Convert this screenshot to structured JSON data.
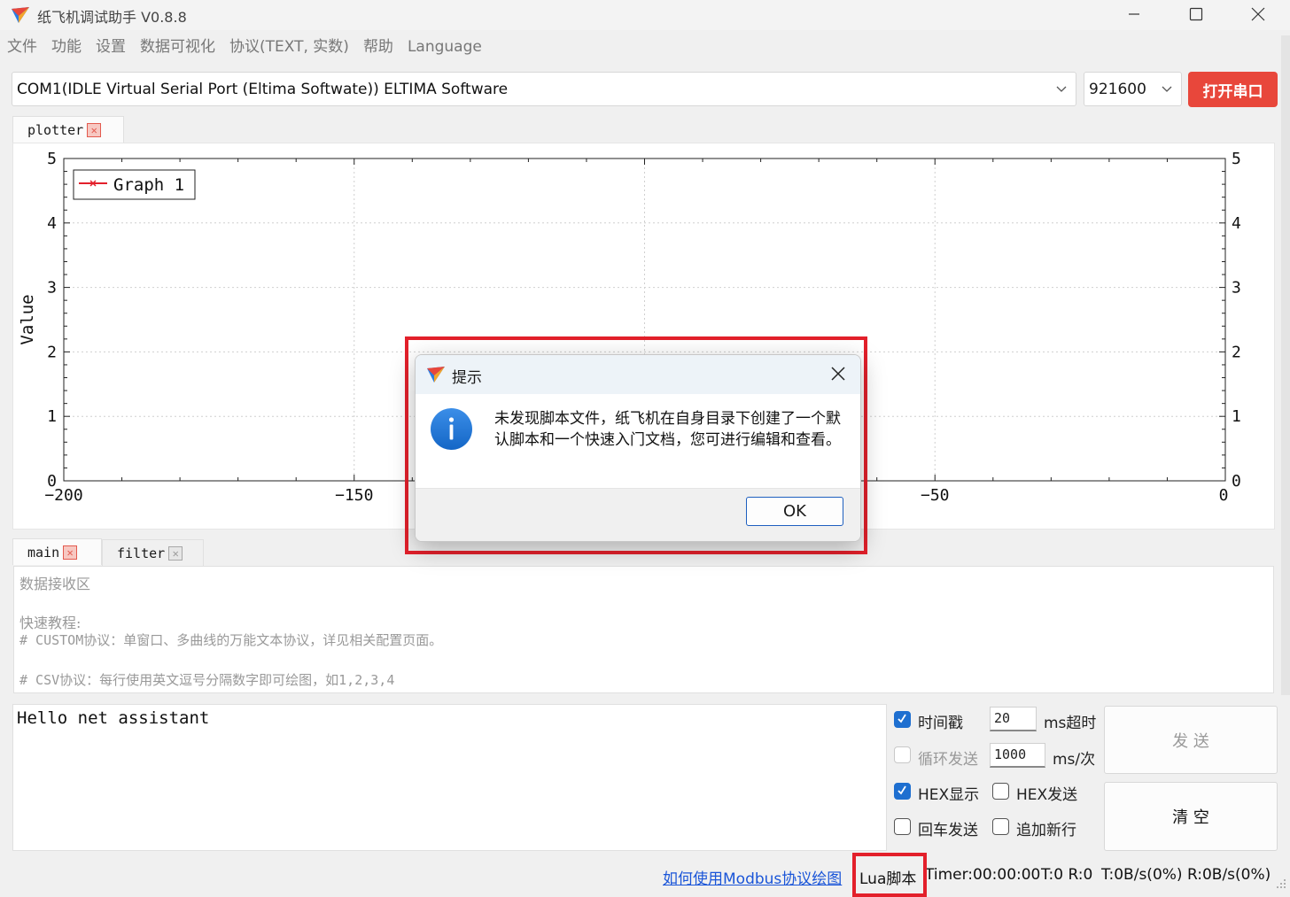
{
  "window": {
    "title": "纸飞机调试助手 V0.8.8"
  },
  "menu": [
    "文件",
    "功能",
    "设置",
    "数据可视化",
    "协议(TEXT, 实数)",
    "帮助",
    "Language"
  ],
  "port": {
    "selected": "COM1(IDLE  Virtual Serial Port (Eltima Softwate)) ELTIMA Software",
    "baud": "921600",
    "open_button": "打开串口"
  },
  "plot_tab": {
    "label": "plotter",
    "close": "✕"
  },
  "chart_data": {
    "type": "line",
    "series": [
      {
        "name": "Graph 1",
        "x": [],
        "y": [],
        "color": "#e3202b"
      }
    ],
    "ylabel": "Value",
    "xlim": [
      -200,
      0
    ],
    "ylim": [
      0,
      5
    ],
    "x_ticks": [
      "−200",
      "−150",
      "−100",
      "−50",
      "0"
    ],
    "y_ticks": [
      "0",
      "1",
      "2",
      "3",
      "4",
      "5"
    ],
    "y_ticks_right": [
      "0",
      "1",
      "2",
      "3",
      "4",
      "5"
    ],
    "grid": true,
    "legend": "top-left"
  },
  "data_tabs": [
    {
      "label": "main",
      "close": "✕"
    },
    {
      "label": "filter",
      "close": "✕"
    }
  ],
  "receive": {
    "title": "数据接收区",
    "tutorial_header": "快速教程:",
    "line1": "# CUSTOM协议：单窗口、多曲线的万能文本协议，详见相关配置页面。",
    "line2": "# CSV协议：每行使用英文逗号分隔数字即可绘图，如1,2,3,4"
  },
  "send": {
    "text": "Hello net assistant"
  },
  "options": {
    "timestamp": {
      "label": "时间戳",
      "checked": true,
      "value": "20",
      "unit": "ms超时"
    },
    "loop_send": {
      "label": "循环发送",
      "checked": false,
      "value": "1000",
      "unit": "ms/次"
    },
    "hex_display": {
      "label": "HEX显示",
      "checked": true
    },
    "hex_send": {
      "label": "HEX发送",
      "checked": false
    },
    "enter_send": {
      "label": "回车发送",
      "checked": false
    },
    "append_newline": {
      "label": "追加新行",
      "checked": false
    }
  },
  "buttons": {
    "send": "发 送",
    "clear": "清 空"
  },
  "status": {
    "modbus_link": "如何使用Modbus协议绘图",
    "lua": "Lua脚本",
    "timer": "Timer:00:00:00",
    "tr": "T:0 R:0",
    "rate": "T:0B/s(0%) R:0B/s(0%)"
  },
  "dialog": {
    "title": "提示",
    "message": "未发现脚本文件，纸飞机在自身目录下创建了一个默认脚本和一个快速入门文档，您可进行编辑和查看。",
    "ok": "OK"
  },
  "colors": {
    "accent": "#e8473b",
    "highlight": "#e3202b",
    "link": "#1a55d8",
    "check": "#1e6fd0"
  }
}
